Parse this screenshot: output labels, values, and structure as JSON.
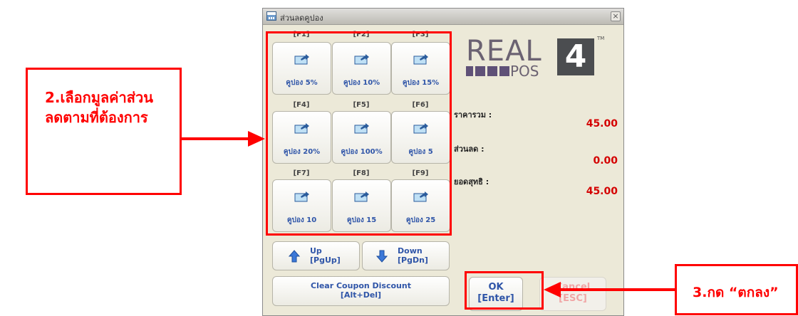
{
  "window": {
    "title": "ส่วนลดคูปอง",
    "close_glyph": "×"
  },
  "coupons": [
    {
      "fkey": "[F1]",
      "label": "คูปอง 5%"
    },
    {
      "fkey": "[F2]",
      "label": "คูปอง 10%"
    },
    {
      "fkey": "[F3]",
      "label": "คูปอง 15%"
    },
    {
      "fkey": "[F4]",
      "label": "คูปอง 20%"
    },
    {
      "fkey": "[F5]",
      "label": "คูปอง 100%"
    },
    {
      "fkey": "[F6]",
      "label": "คูปอง 5"
    },
    {
      "fkey": "[F7]",
      "label": "คูปอง 10"
    },
    {
      "fkey": "[F8]",
      "label": "คูปอง 15"
    },
    {
      "fkey": "[F9]",
      "label": "คูปอง 25"
    }
  ],
  "paging": {
    "up_label": "Up",
    "up_key": "[PgUp]",
    "down_label": "Down",
    "down_key": "[PgDn]"
  },
  "clear": {
    "label": "Clear Coupon Discount",
    "key": "[Alt+Del]"
  },
  "logo": {
    "word": "REAL",
    "sub": "POS",
    "number": "4",
    "tm": "TM"
  },
  "summary": {
    "total_label": "ราคารวม :",
    "total_value": "45.00",
    "discount_label": "ส่วนลด :",
    "discount_value": "0.00",
    "net_label": "ยอดสุทธิ :",
    "net_value": "45.00"
  },
  "actions": {
    "ok_label": "OK",
    "ok_key": "[Enter]",
    "cancel_label": "Cancel",
    "cancel_key": "[ESC]"
  },
  "annotations": {
    "step2_line1": "2.เลือกมูลค่าส่วน",
    "step2_line2": "ลดตามที่ต้องการ",
    "step3": "3.กด “ตกลง”"
  },
  "colors": {
    "annotation": "#ff0000",
    "value_text": "#d40000",
    "button_text": "#2f55a8",
    "dialog_bg": "#ece9d8"
  }
}
